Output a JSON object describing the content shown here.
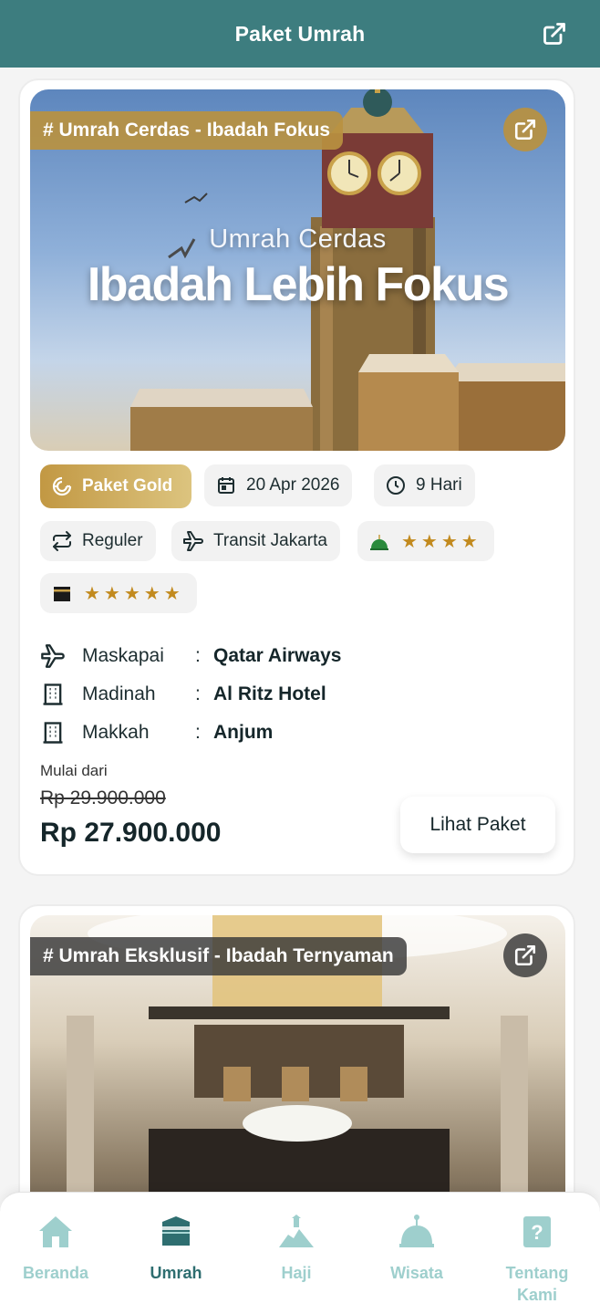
{
  "header": {
    "title": "Paket Umrah"
  },
  "packages": [
    {
      "tag": "# Umrah Cerdas - Ibadah Fokus",
      "banner_subtitle": "Umrah Cerdas",
      "banner_headline": "Ibadah Lebih Fokus",
      "tier": "Paket Gold",
      "date": "20 Apr 2026",
      "duration": "9 Hari",
      "type": "Reguler",
      "transit": "Transit Jakarta",
      "madinah_stars": "★★★★",
      "makkah_stars": "★★★★★",
      "airline_label": "Maskapai",
      "airline": "Qatar Airways",
      "madinah_label": "Madinah",
      "madinah_hotel": "Al Ritz Hotel",
      "makkah_label": "Makkah",
      "makkah_hotel": "Anjum",
      "price_from_label": "Mulai dari",
      "price_old": "Rp 29.900.000",
      "price_new": "Rp 27.900.000",
      "cta": "Lihat Paket"
    },
    {
      "tag": "# Umrah Eksklusif - Ibadah Ternyaman"
    }
  ],
  "colon": ":",
  "nav": {
    "items": [
      {
        "label": "Beranda"
      },
      {
        "label": "Umrah"
      },
      {
        "label": "Haji"
      },
      {
        "label": "Wisata"
      },
      {
        "label": "Tentang Kami"
      }
    ]
  },
  "colors": {
    "header": "#3d7d7f",
    "accent_gold": "#b89140",
    "nav_active": "#2e6e70",
    "nav_inactive": "#9ecfcd",
    "star": "#c28a1e"
  }
}
